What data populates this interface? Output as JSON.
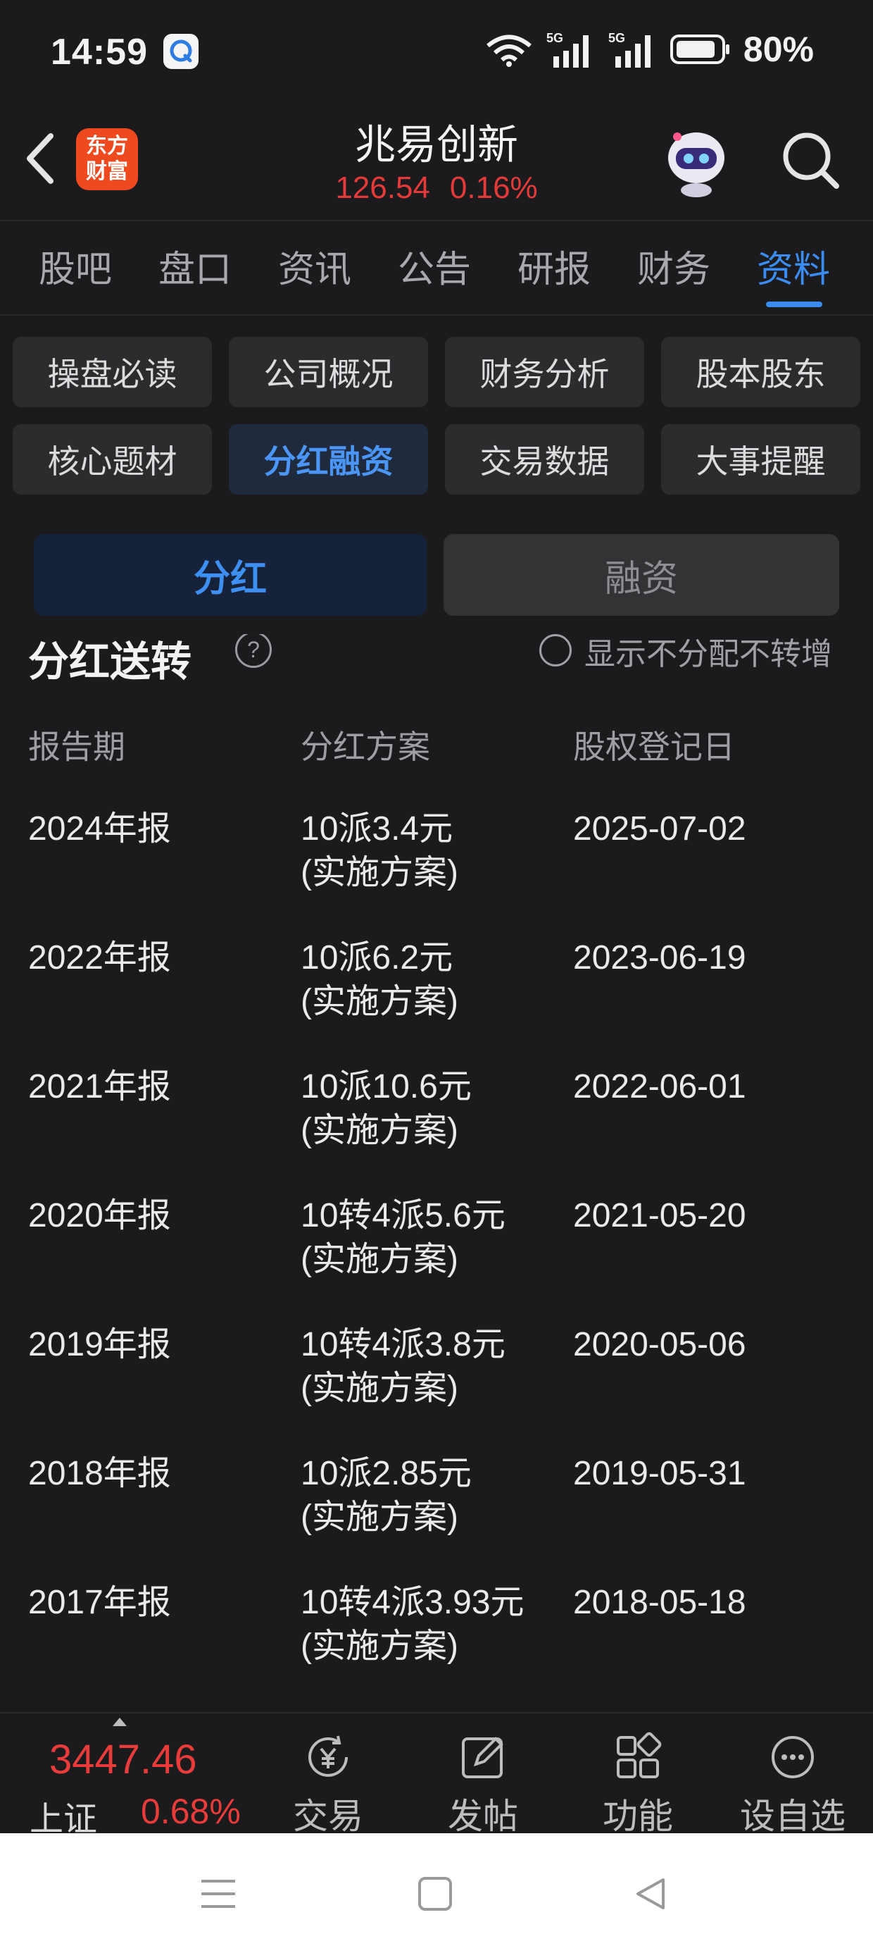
{
  "status_bar": {
    "time": "14:59",
    "battery": "80%"
  },
  "header": {
    "logo_line1": "东方",
    "logo_line2": "财富",
    "title": "兆易创新",
    "price": "126.54",
    "change_pct": "0.16%"
  },
  "tabs": [
    "股吧",
    "盘口",
    "资讯",
    "公告",
    "研报",
    "财务",
    "资料"
  ],
  "active_tab": "资料",
  "chips": [
    "操盘必读",
    "公司概况",
    "财务分析",
    "股本股东",
    "核心题材",
    "分红融资",
    "交易数据",
    "大事提醒"
  ],
  "active_chip": "分红融资",
  "segment": {
    "left": "分红",
    "right": "融资"
  },
  "section": {
    "title": "分红送转",
    "filter_label": "显示不分配不转增"
  },
  "table": {
    "headers": [
      "报告期",
      "分红方案",
      "股权登记日"
    ],
    "rows": [
      {
        "period": "2024年报",
        "plan": "10派3.4元",
        "note": "(实施方案)",
        "date": "2025-07-02"
      },
      {
        "period": "2022年报",
        "plan": "10派6.2元",
        "note": "(实施方案)",
        "date": "2023-06-19"
      },
      {
        "period": "2021年报",
        "plan": "10派10.6元",
        "note": "(实施方案)",
        "date": "2022-06-01"
      },
      {
        "period": "2020年报",
        "plan": "10转4派5.6元",
        "note": "(实施方案)",
        "date": "2021-05-20"
      },
      {
        "period": "2019年报",
        "plan": "10转4派3.8元",
        "note": "(实施方案)",
        "date": "2020-05-06"
      },
      {
        "period": "2018年报",
        "plan": "10派2.85元",
        "note": "(实施方案)",
        "date": "2019-05-31"
      },
      {
        "period": "2017年报",
        "plan": "10转4派3.93元",
        "note": "(实施方案)",
        "date": "2018-05-18"
      }
    ]
  },
  "bottom_bar": {
    "index_value": "3447.46",
    "index_name": "上证",
    "index_pct": "0.68%",
    "items": [
      "交易",
      "发帖",
      "功能",
      "设自选"
    ]
  },
  "colors": {
    "accent": "#3b8cf0",
    "up": "#e63a3a",
    "background": "#1b1b1d"
  }
}
